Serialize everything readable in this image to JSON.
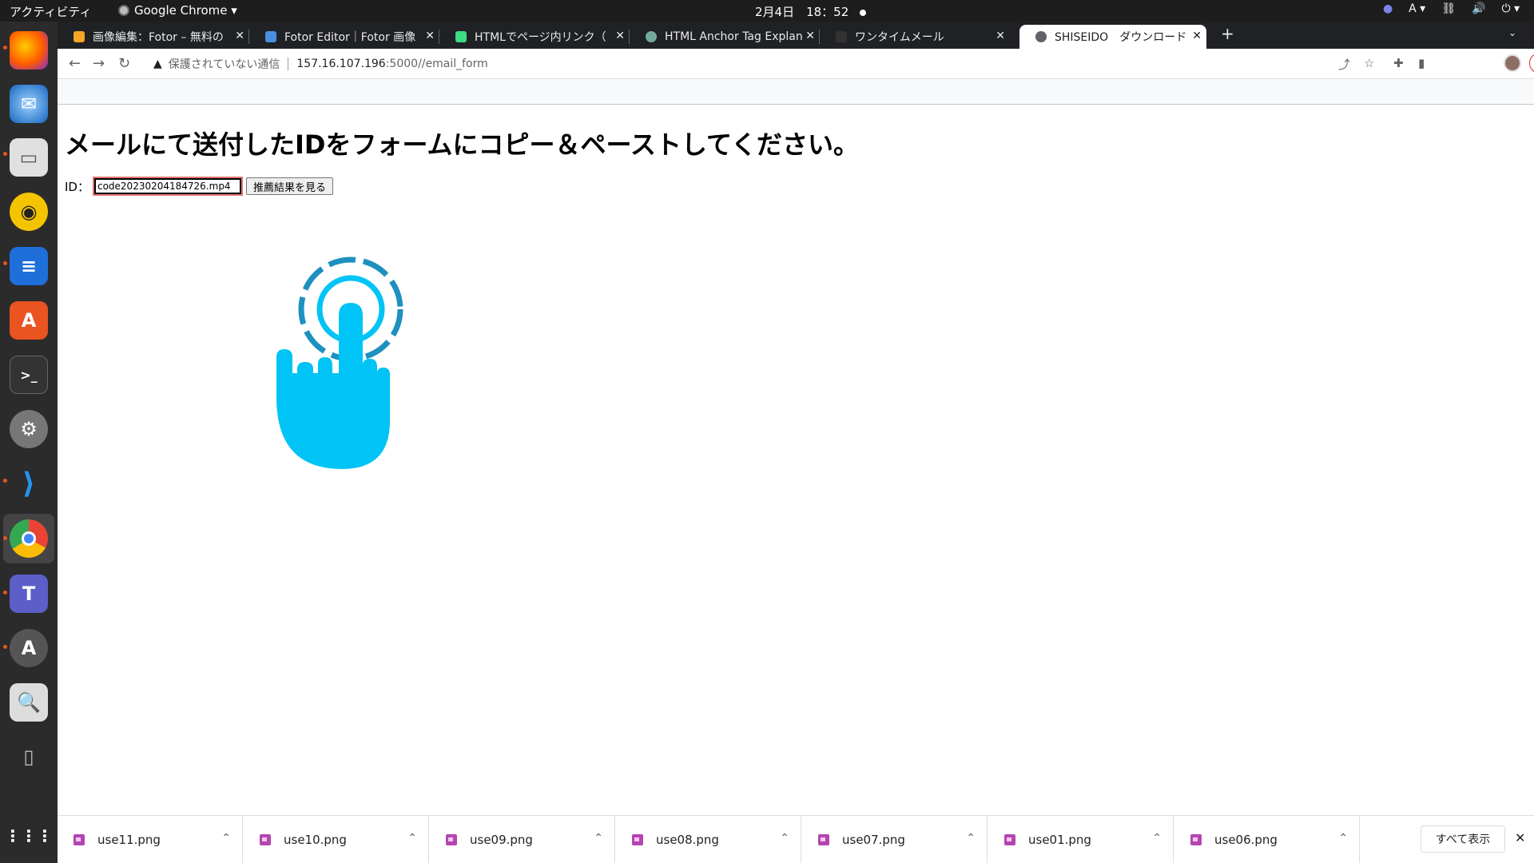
{
  "topbar": {
    "activities": "アクティビティ",
    "app_name": "Google Chrome ▾",
    "clock": "2月4日　18：52",
    "input_method": "A ▾",
    "tray_icons": [
      "network-icon",
      "volume-icon",
      "power-icon"
    ]
  },
  "dock": {
    "apps": [
      "firefox",
      "thunderbird",
      "files",
      "rhythmbox",
      "libreoffice-writer",
      "app-center",
      "terminal",
      "settings",
      "vscode",
      "chrome",
      "teams",
      "software-updater",
      "search",
      "usb-drive",
      "show-applications"
    ],
    "active_app": "chrome"
  },
  "tabs": [
    {
      "title": "画像編集：Fotor – 無料の",
      "favicon_color": "#f5a623"
    },
    {
      "title": "Fotor Editor｜Fotor 画像",
      "favicon_color": "#4a90e2"
    },
    {
      "title": "HTMLでページ内リンク（",
      "favicon_color": "#3ddc84"
    },
    {
      "title": "HTML Anchor Tag Explan",
      "favicon_color": "#74aa9c"
    },
    {
      "title": "ワンタイムメール",
      "favicon_color": "#333333"
    },
    {
      "title": "SHISEIDO　ダウンロード",
      "favicon_color": "#5f6368",
      "active": true
    }
  ],
  "address_bar": {
    "security_warning": "保護されていない通信",
    "host": "157.16.107.196",
    "path": ":5000//email_form"
  },
  "toolbar": {
    "update_label": "更新"
  },
  "page": {
    "heading": "メールにて送付したIDをフォームにコピー＆ペーストしてください。",
    "id_label": "ID：",
    "id_value": "code20230204184726.mp4",
    "submit_label": "推薦結果を見る"
  },
  "downloads": {
    "files": [
      "use11.png",
      "use10.png",
      "use09.png",
      "use08.png",
      "use07.png",
      "use01.png",
      "use06.png"
    ],
    "show_all_label": "すべて表示"
  },
  "colors": {
    "pointer_hand": "#00c4f5",
    "pointer_ring": "#1e90c0",
    "accent": "#e95420"
  }
}
